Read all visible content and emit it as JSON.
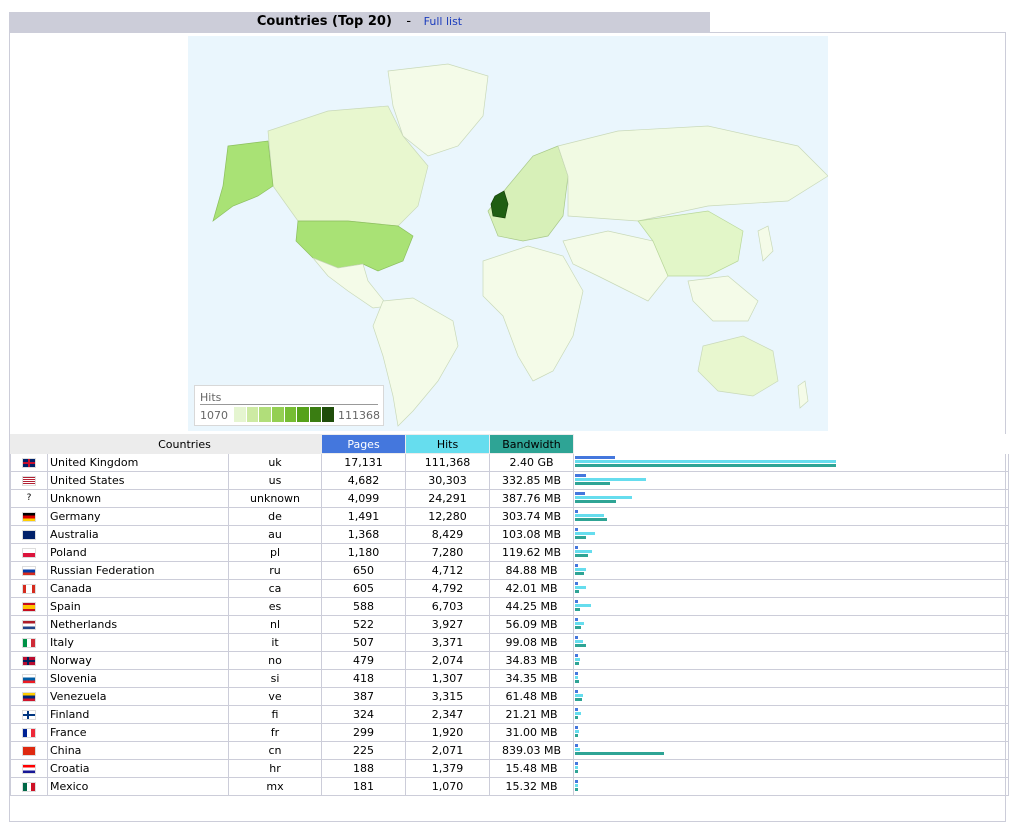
{
  "header": {
    "title": "Countries (Top 20)",
    "separator": "-",
    "full_list_link": "Full list"
  },
  "map": {
    "legend_title": "Hits",
    "legend_min": "1070",
    "legend_max": "111368",
    "scale_colors": [
      "#e5f5d0",
      "#cdeaa3",
      "#b1de7a",
      "#94cf52",
      "#76bd33",
      "#56a21b",
      "#3a7d12",
      "#1f4d0a"
    ],
    "ocean_color": "#eaf6fd",
    "land_color": "#f4fbe8",
    "highlight_colors": {
      "uk": "#1f5e12",
      "us": "#a9e275",
      "alaska": "#a9e275",
      "canada": "#e8f7cf",
      "europe": "#d7f0b8",
      "china": "#e2f6c8",
      "russia": "#f1fae3"
    }
  },
  "table": {
    "headers": {
      "countries": "Countries",
      "pages": "Pages",
      "hits": "Hits",
      "bandwidth": "Bandwidth"
    },
    "colors": {
      "pages": "#4477dd",
      "hits": "#66ddee",
      "bandwidth": "#2ea495"
    },
    "rows": [
      {
        "flag": "uk-flag-icon",
        "country": "United Kingdom",
        "code": "uk",
        "pages": "17,131",
        "hits": "111,368",
        "bandwidth": "2.40 GB",
        "pages_v": 17131,
        "hits_v": 111368,
        "bw_mb": 2457.6
      },
      {
        "flag": "us-flag-icon",
        "country": "United States",
        "code": "us",
        "pages": "4,682",
        "hits": "30,303",
        "bandwidth": "332.85 MB",
        "pages_v": 4682,
        "hits_v": 30303,
        "bw_mb": 332.85
      },
      {
        "flag": "unknown-flag-icon",
        "country": "Unknown",
        "code": "unknown",
        "pages": "4,099",
        "hits": "24,291",
        "bandwidth": "387.76 MB",
        "pages_v": 4099,
        "hits_v": 24291,
        "bw_mb": 387.76
      },
      {
        "flag": "de-flag-icon",
        "country": "Germany",
        "code": "de",
        "pages": "1,491",
        "hits": "12,280",
        "bandwidth": "303.74 MB",
        "pages_v": 1491,
        "hits_v": 12280,
        "bw_mb": 303.74
      },
      {
        "flag": "au-flag-icon",
        "country": "Australia",
        "code": "au",
        "pages": "1,368",
        "hits": "8,429",
        "bandwidth": "103.08 MB",
        "pages_v": 1368,
        "hits_v": 8429,
        "bw_mb": 103.08
      },
      {
        "flag": "pl-flag-icon",
        "country": "Poland",
        "code": "pl",
        "pages": "1,180",
        "hits": "7,280",
        "bandwidth": "119.62 MB",
        "pages_v": 1180,
        "hits_v": 7280,
        "bw_mb": 119.62
      },
      {
        "flag": "ru-flag-icon",
        "country": "Russian Federation",
        "code": "ru",
        "pages": "650",
        "hits": "4,712",
        "bandwidth": "84.88 MB",
        "pages_v": 650,
        "hits_v": 4712,
        "bw_mb": 84.88
      },
      {
        "flag": "ca-flag-icon",
        "country": "Canada",
        "code": "ca",
        "pages": "605",
        "hits": "4,792",
        "bandwidth": "42.01 MB",
        "pages_v": 605,
        "hits_v": 4792,
        "bw_mb": 42.01
      },
      {
        "flag": "es-flag-icon",
        "country": "Spain",
        "code": "es",
        "pages": "588",
        "hits": "6,703",
        "bandwidth": "44.25 MB",
        "pages_v": 588,
        "hits_v": 6703,
        "bw_mb": 44.25
      },
      {
        "flag": "nl-flag-icon",
        "country": "Netherlands",
        "code": "nl",
        "pages": "522",
        "hits": "3,927",
        "bandwidth": "56.09 MB",
        "pages_v": 522,
        "hits_v": 3927,
        "bw_mb": 56.09
      },
      {
        "flag": "it-flag-icon",
        "country": "Italy",
        "code": "it",
        "pages": "507",
        "hits": "3,371",
        "bandwidth": "99.08 MB",
        "pages_v": 507,
        "hits_v": 3371,
        "bw_mb": 99.08
      },
      {
        "flag": "no-flag-icon",
        "country": "Norway",
        "code": "no",
        "pages": "479",
        "hits": "2,074",
        "bandwidth": "34.83 MB",
        "pages_v": 479,
        "hits_v": 2074,
        "bw_mb": 34.83
      },
      {
        "flag": "si-flag-icon",
        "country": "Slovenia",
        "code": "si",
        "pages": "418",
        "hits": "1,307",
        "bandwidth": "34.35 MB",
        "pages_v": 418,
        "hits_v": 1307,
        "bw_mb": 34.35
      },
      {
        "flag": "ve-flag-icon",
        "country": "Venezuela",
        "code": "ve",
        "pages": "387",
        "hits": "3,315",
        "bandwidth": "61.48 MB",
        "pages_v": 387,
        "hits_v": 3315,
        "bw_mb": 61.48
      },
      {
        "flag": "fi-flag-icon",
        "country": "Finland",
        "code": "fi",
        "pages": "324",
        "hits": "2,347",
        "bandwidth": "21.21 MB",
        "pages_v": 324,
        "hits_v": 2347,
        "bw_mb": 21.21
      },
      {
        "flag": "fr-flag-icon",
        "country": "France",
        "code": "fr",
        "pages": "299",
        "hits": "1,920",
        "bandwidth": "31.00 MB",
        "pages_v": 299,
        "hits_v": 1920,
        "bw_mb": 31.0
      },
      {
        "flag": "cn-flag-icon",
        "country": "China",
        "code": "cn",
        "pages": "225",
        "hits": "2,071",
        "bandwidth": "839.03 MB",
        "pages_v": 225,
        "hits_v": 2071,
        "bw_mb": 839.03
      },
      {
        "flag": "hr-flag-icon",
        "country": "Croatia",
        "code": "hr",
        "pages": "188",
        "hits": "1,379",
        "bandwidth": "15.48 MB",
        "pages_v": 188,
        "hits_v": 1379,
        "bw_mb": 15.48
      },
      {
        "flag": "mx-flag-icon",
        "country": "Mexico",
        "code": "mx",
        "pages": "181",
        "hits": "1,070",
        "bandwidth": "15.32 MB",
        "pages_v": 181,
        "hits_v": 1070,
        "bw_mb": 15.32
      }
    ]
  }
}
